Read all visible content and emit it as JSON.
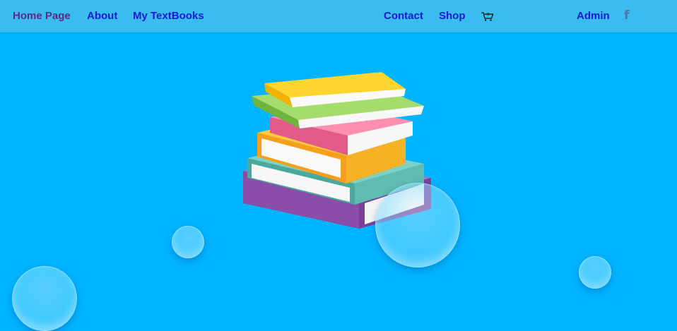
{
  "nav": {
    "home": "Home Page",
    "about": "About",
    "textbooks": "My TextBooks",
    "contact": "Contact",
    "shop": "Shop",
    "cart_count": "0",
    "admin": "Admin",
    "facebook_glyph": "f"
  },
  "icons": {
    "cart": "shopping-cart-icon",
    "facebook": "facebook-icon"
  },
  "hero": {
    "image": "stack-of-books-illustration"
  },
  "colors": {
    "background": "#00b4ff",
    "navbar": "#3bbcee",
    "link": "#1a1ad6",
    "active_link": "#5b2a86"
  }
}
